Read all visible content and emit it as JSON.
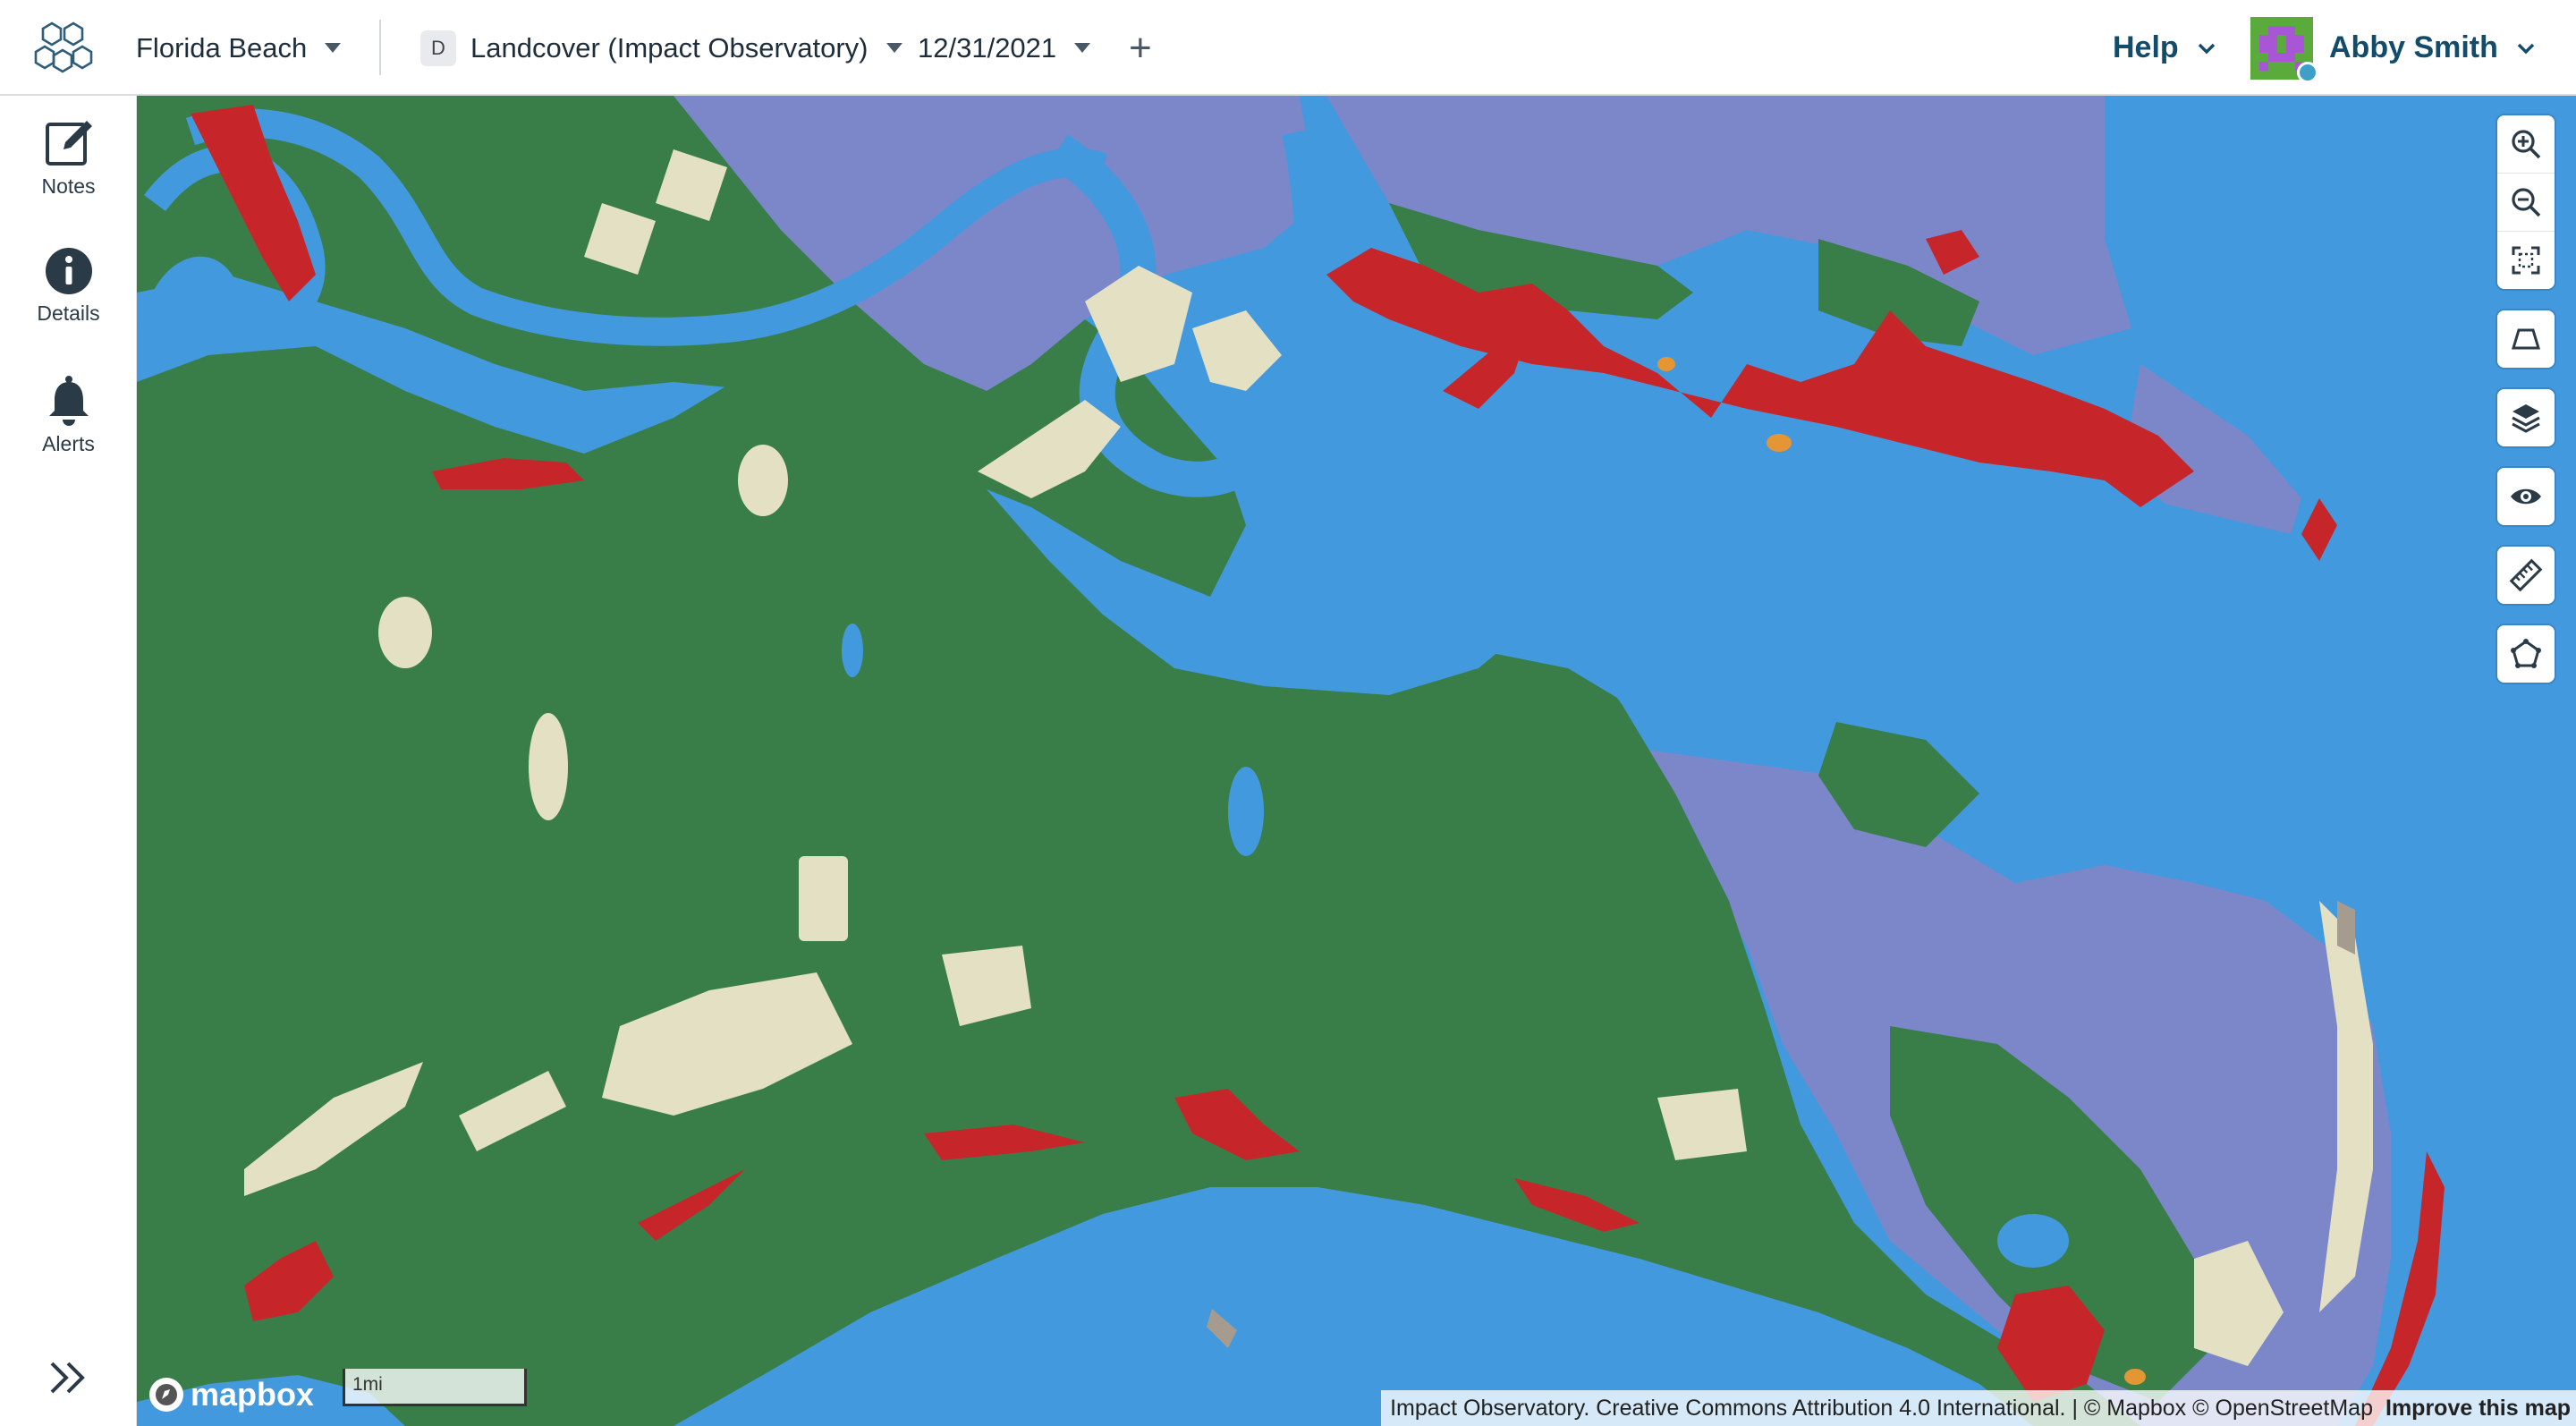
{
  "header": {
    "project": "Florida Beach",
    "dataset_badge": "D",
    "dataset": "Landcover (Impact Observatory)",
    "date": "12/31/2021",
    "add_symbol": "+",
    "help": "Help",
    "user_name": "Abby Smith"
  },
  "sidebar": {
    "items": [
      {
        "label": "Notes",
        "icon": "edit-icon"
      },
      {
        "label": "Details",
        "icon": "info-icon"
      },
      {
        "label": "Alerts",
        "icon": "bell-icon"
      }
    ],
    "expand_icon": "double-chevron-right-icon"
  },
  "map": {
    "colors": {
      "water": "#4299de",
      "trees": "#397e49",
      "flooded_vegetation": "#7c87c9",
      "built_area": "#c6262a",
      "bare_ground": "#e4e0c4",
      "crops": "#e49635",
      "rangeland": "#a59b8f"
    },
    "controls": [
      "zoom-in-icon",
      "zoom-out-icon",
      "fit-bounds-icon",
      "perspective-icon",
      "layers-icon",
      "eye-icon",
      "ruler-icon",
      "polygon-draw-icon"
    ],
    "logo": "mapbox",
    "scale_label": "1mi",
    "attribution": "Impact Observatory. Creative Commons Attribution 4.0 International. | © Mapbox © OpenStreetMap",
    "improve_link": "Improve this map"
  }
}
